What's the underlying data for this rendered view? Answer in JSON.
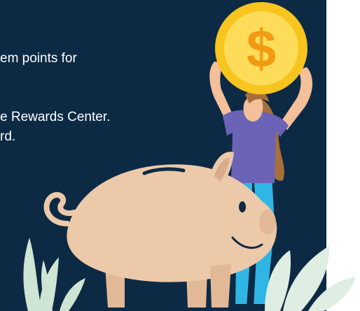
{
  "promo": {
    "line1": "em points for",
    "line2": "e Rewards Center.",
    "line3": "rd."
  },
  "colors": {
    "panel_bg": "#0d2a45",
    "coin_gold": "#f7c51e",
    "coin_inner": "#fddc5a",
    "pig_body": "#ecc9a9",
    "shirt_purple": "#6a63b6",
    "pants_blue": "#2fb6e4",
    "hair_brown": "#a86f3a",
    "leaf_green": "#cfe5d4"
  },
  "icons": {
    "coin": "dollar-coin-icon",
    "piggy": "piggy-bank-icon"
  }
}
